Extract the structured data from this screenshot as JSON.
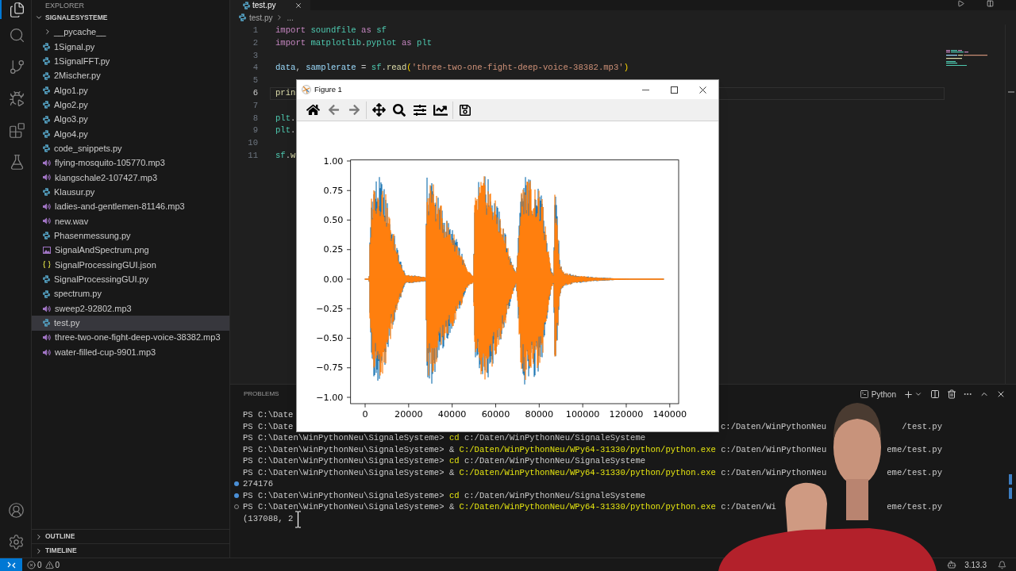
{
  "activity_bar": {
    "items": [
      {
        "kind": "explorer",
        "selected": true
      },
      {
        "kind": "search",
        "selected": false
      },
      {
        "kind": "source_control",
        "selected": false
      },
      {
        "kind": "run_debug",
        "selected": false
      },
      {
        "kind": "extensions",
        "selected": false
      },
      {
        "kind": "testing",
        "selected": false
      }
    ]
  },
  "explorer": {
    "title": "EXPLORER",
    "root": {
      "name": "SIGNALESYSTEME",
      "expanded": true,
      "children": [
        {
          "name": "__pycache__",
          "kind": "folder",
          "expanded": false,
          "selected": false
        },
        {
          "name": "1Signal.py",
          "kind": "python",
          "selected": false
        },
        {
          "name": "1SignalFFT.py",
          "kind": "python",
          "selected": false
        },
        {
          "name": "2Mischer.py",
          "kind": "python",
          "selected": false
        },
        {
          "name": "Algo1.py",
          "kind": "python",
          "selected": false
        },
        {
          "name": "Algo2.py",
          "kind": "python",
          "selected": false
        },
        {
          "name": "Algo3.py",
          "kind": "python",
          "selected": false
        },
        {
          "name": "Algo4.py",
          "kind": "python",
          "selected": false
        },
        {
          "name": "code_snippets.py",
          "kind": "python",
          "selected": false
        },
        {
          "name": "flying-mosquito-105770.mp3",
          "kind": "audio",
          "selected": false
        },
        {
          "name": "klangschale2-107427.mp3",
          "kind": "audio",
          "selected": false
        },
        {
          "name": "Klausur.py",
          "kind": "python",
          "selected": false
        },
        {
          "name": "ladies-and-gentlemen-81146.mp3",
          "kind": "audio",
          "selected": false
        },
        {
          "name": "new.wav",
          "kind": "audio",
          "selected": false
        },
        {
          "name": "Phasenmessung.py",
          "kind": "python",
          "selected": false
        },
        {
          "name": "SignalAndSpectrum.png",
          "kind": "image",
          "selected": false
        },
        {
          "name": "SignalProcessingGUI.json",
          "kind": "json",
          "selected": false
        },
        {
          "name": "SignalProcessingGUI.py",
          "kind": "python",
          "selected": false
        },
        {
          "name": "spectrum.py",
          "kind": "python",
          "selected": false
        },
        {
          "name": "sweep2-92802.mp3",
          "kind": "audio",
          "selected": false
        },
        {
          "name": "test.py",
          "kind": "python",
          "selected": true
        },
        {
          "name": "three-two-one-fight-deep-voice-38382.mp3",
          "kind": "audio",
          "selected": false
        },
        {
          "name": "water-filled-cup-9901.mp3",
          "kind": "audio",
          "selected": false
        }
      ]
    },
    "sections": [
      {
        "label": "OUTLINE",
        "expanded": false
      },
      {
        "label": "TIMELINE",
        "expanded": false
      }
    ]
  },
  "editor": {
    "tabs": [
      {
        "label": "test.py",
        "selected": true
      }
    ],
    "breadcrumb": [
      {
        "label": "test.py",
        "kind": "file"
      },
      {
        "label": "...",
        "kind": "symbol"
      }
    ],
    "lines": [
      {
        "number": "1",
        "current": false,
        "tokens": [
          {
            "text": "import",
            "kind": "keyword"
          },
          {
            "text": " soundfile",
            "kind": "module"
          },
          {
            "text": " as",
            "kind": "keyword"
          },
          {
            "text": " sf",
            "kind": "module"
          }
        ]
      },
      {
        "number": "2",
        "current": false,
        "tokens": [
          {
            "text": "import",
            "kind": "keyword"
          },
          {
            "text": " matplotlib",
            "kind": "module"
          },
          {
            "text": ".",
            "kind": "plain"
          },
          {
            "text": "pyplot",
            "kind": "module"
          },
          {
            "text": " as",
            "kind": "keyword"
          },
          {
            "text": " plt",
            "kind": "module"
          }
        ]
      },
      {
        "number": "3",
        "current": false
      },
      {
        "number": "4",
        "current": false,
        "tokens": [
          {
            "text": "data",
            "kind": "variable"
          },
          {
            "text": ", ",
            "kind": "plain"
          },
          {
            "text": "samplerate",
            "kind": "variable"
          },
          {
            "text": " = ",
            "kind": "plain"
          },
          {
            "text": "sf",
            "kind": "module"
          },
          {
            "text": ".",
            "kind": "plain"
          },
          {
            "text": "read",
            "kind": "function"
          },
          {
            "text": "(",
            "kind": "bracket"
          },
          {
            "text": "'three-two-one-fight-deep-voice-38382.mp3'",
            "kind": "string"
          },
          {
            "text": ")",
            "kind": "bracket"
          }
        ]
      },
      {
        "number": "5",
        "current": false
      },
      {
        "number": "6",
        "current": true,
        "tokens": [
          {
            "text": "prin",
            "kind": "function"
          }
        ]
      },
      {
        "number": "7",
        "current": false
      },
      {
        "number": "8",
        "current": false,
        "tokens": [
          {
            "text": "plt",
            "kind": "module"
          },
          {
            "text": ".",
            "kind": "plain"
          }
        ]
      },
      {
        "number": "9",
        "current": false,
        "tokens": [
          {
            "text": "plt",
            "kind": "module"
          },
          {
            "text": ".",
            "kind": "plain"
          }
        ]
      },
      {
        "number": "10",
        "current": false
      },
      {
        "number": "11",
        "current": false,
        "tokens": [
          {
            "text": "sf",
            "kind": "module"
          },
          {
            "text": ".",
            "kind": "plain"
          },
          {
            "text": "w",
            "kind": "function"
          }
        ]
      }
    ]
  },
  "panel": {
    "tabs": [
      {
        "label": "PROBLEMS",
        "selected": false
      }
    ],
    "terminal_name": "Python",
    "lines": [
      {
        "segments": [
          {
            "text": "PS C:\\Date",
            "kind": "plain"
          }
        ]
      },
      {
        "segments": [
          {
            "text": "PS C:\\Date",
            "kind": "plain"
          }
        ],
        "resume": [
          {
            "text": "c:/Daten/WinPythonNeu",
            "kind": "plain"
          }
        ],
        "tail": "/test.py"
      },
      {
        "segments": [
          {
            "text": "PS C:\\Daten\\WinPythonNeu\\SignaleSysteme> ",
            "kind": "plain"
          },
          {
            "text": "cd",
            "kind": "command"
          },
          {
            "text": " c:/Daten/WinPythonNeu/SignaleSysteme",
            "kind": "plain"
          }
        ]
      },
      {
        "segments": [
          {
            "text": "PS C:\\Daten\\WinPythonNeu\\SignaleSysteme> & ",
            "kind": "plain"
          },
          {
            "text": "C:/Daten/WinPythonNeu/WPy64-31330/python/python.exe",
            "kind": "command"
          },
          {
            "text": " c:/Daten/WinPythonNeu",
            "kind": "plain"
          }
        ],
        "tail": "eme/test.py"
      },
      {
        "segments": [
          {
            "text": "PS C:\\Daten\\WinPythonNeu\\SignaleSysteme> ",
            "kind": "plain"
          },
          {
            "text": "cd",
            "kind": "command"
          },
          {
            "text": " c:/Daten/WinPythonNeu/SignaleSysteme",
            "kind": "plain"
          }
        ]
      },
      {
        "segments": [
          {
            "text": "PS C:\\Daten\\WinPythonNeu\\SignaleSysteme> & ",
            "kind": "plain"
          },
          {
            "text": "C:/Daten/WinPythonNeu/WPy64-31330/python/python.exe",
            "kind": "command"
          },
          {
            "text": " c:/Daten/WinPythonNeu",
            "kind": "plain"
          }
        ],
        "tail": "eme/test.py"
      },
      {
        "marker": {
          "filled": true
        },
        "segments": [
          {
            "text": "274176",
            "kind": "plain"
          }
        ]
      },
      {
        "marker": {
          "filled": true
        },
        "segments": [
          {
            "text": "PS C:\\Daten\\WinPythonNeu\\SignaleSysteme> ",
            "kind": "plain"
          },
          {
            "text": "cd",
            "kind": "command"
          },
          {
            "text": " c:/Daten/WinPythonNeu/SignaleSysteme",
            "kind": "plain"
          }
        ]
      },
      {
        "marker": {
          "filled": false
        },
        "segments": [
          {
            "text": "PS C:\\Daten\\WinPythonNeu\\SignaleSysteme> & ",
            "kind": "plain"
          },
          {
            "text": "C:/Daten/WinPythonNeu/WPy64-31330/python/python.exe",
            "kind": "command"
          },
          {
            "text": " c:/Daten/Wi",
            "kind": "plain"
          }
        ],
        "tail": "eme/test.py"
      },
      {
        "segments": [
          {
            "text": "(137088, 2",
            "kind": "plain"
          }
        ]
      }
    ]
  },
  "status_bar": {
    "errors": "0",
    "warnings": "0",
    "python_version": "3.13.3"
  },
  "figure_window": {
    "title": "Figure 1",
    "toolbar_groups": [
      {
        "tools": [
          {
            "kind": "home",
            "disabled": false
          },
          {
            "kind": "back",
            "disabled": true
          },
          {
            "kind": "forward",
            "disabled": true
          }
        ]
      },
      {
        "tools": [
          {
            "kind": "pan",
            "disabled": false
          },
          {
            "kind": "zoom",
            "disabled": false
          },
          {
            "kind": "configure",
            "disabled": false
          },
          {
            "kind": "edit",
            "disabled": false
          }
        ]
      },
      {
        "tools": [
          {
            "kind": "save",
            "disabled": false
          }
        ]
      }
    ],
    "plot": {
      "y_tick_labels": [
        "1.00",
        "0.75",
        "0.50",
        "0.25",
        "0.00",
        "−0.25",
        "−0.50",
        "−0.75",
        "−1.00"
      ],
      "x_tick_labels": [
        "0",
        "20000",
        "40000",
        "60000",
        "80000",
        "100000",
        "120000",
        "140000"
      ]
    }
  }
}
